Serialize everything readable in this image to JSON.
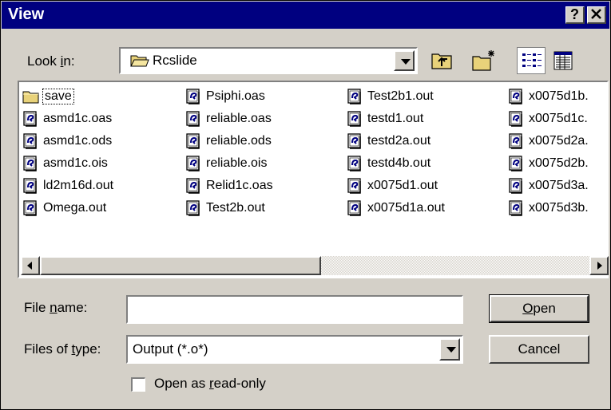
{
  "window": {
    "title": "View",
    "help_button": "?",
    "close_button": "✕"
  },
  "lookin": {
    "label_pre": "Look ",
    "label_key": "i",
    "label_post": "n:",
    "value": "Rcslide",
    "folder_icon": "folder-open-icon"
  },
  "toolbar": {
    "up_one_level": "up-folder-icon",
    "new_folder": "new-folder-icon",
    "list_view": "list-view-icon",
    "details_view": "details-view-icon"
  },
  "files": {
    "col1": [
      "save",
      "asmd1c.oas",
      "asmd1c.ods",
      "asmd1c.ois",
      "ld2m16d.out",
      "Omega.out"
    ],
    "col2": [
      "Psiphi.oas",
      "reliable.oas",
      "reliable.ods",
      "reliable.ois",
      "Relid1c.oas",
      "Test2b.out"
    ],
    "col3": [
      "Test2b1.out",
      "testd1.out",
      "testd2a.out",
      "testd4b.out",
      "x0075d1.out",
      "x0075d1a.out"
    ],
    "col4": [
      "x0075d1b.",
      "x0075d1c.",
      "x0075d2a.",
      "x0075d2b.",
      "x0075d3a.",
      "x0075d3b."
    ]
  },
  "filename": {
    "label_pre": "File ",
    "label_key": "n",
    "label_post": "ame:",
    "value": ""
  },
  "filetype": {
    "label_pre": "Files of ",
    "label_key": "t",
    "label_post": "ype:",
    "value": "Output (*.o*)"
  },
  "buttons": {
    "open_key": "O",
    "open_rest": "pen",
    "cancel": "Cancel"
  },
  "readonly": {
    "label_pre": "Open as ",
    "label_key": "r",
    "label_post": "ead-only",
    "checked": false
  }
}
